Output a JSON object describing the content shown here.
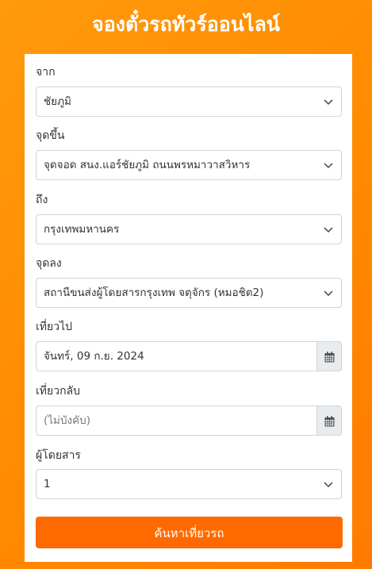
{
  "page": {
    "title": "จองตั๋วรถทัวร์ออนไลน์"
  },
  "form": {
    "from_label": "จาก",
    "from_value": "ชัยภูมิ",
    "pickup_label": "จุดขึ้น",
    "pickup_value": "จุดจอด สนง.แอร์ชัยภูมิ ถนนพรหมาวาสวิหาร",
    "to_label": "ถึง",
    "to_value": "กรุงเทพมหานคร",
    "dropoff_label": "จุดลง",
    "dropoff_value": "สถานีขนส่งผู้โดยสารกรุงเทพ จตุจักร (หมอชิต2)",
    "depart_label": "เที่ยวไป",
    "depart_value": "จันทร์, 09 ก.ย. 2024",
    "return_label": "เที่ยวกลับ",
    "return_placeholder": "(ไม่บังคับ)",
    "passengers_label": "ผู้โดยสาร",
    "passengers_value": "1",
    "search_button": "ค้นหาเที่ยวรถ"
  },
  "icons": {
    "dropdown": "chevron-down-icon",
    "calendar": "calendar-icon"
  },
  "colors": {
    "background": "#ff8a00",
    "button": "#ff6a00",
    "card": "#ffffff"
  }
}
